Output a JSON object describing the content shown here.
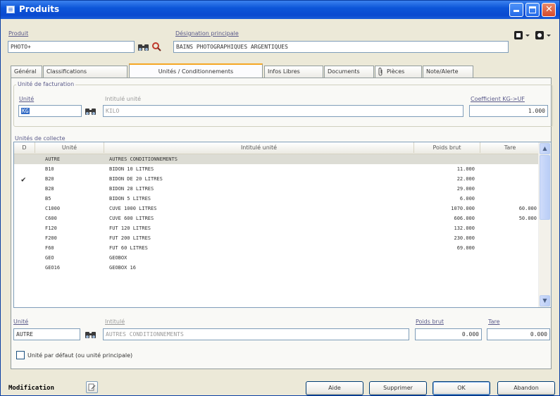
{
  "window": {
    "title": "Produits"
  },
  "header": {
    "product_label": "Produit",
    "product_value": "PHOTO+",
    "designation_label": "Désignation principale",
    "designation_value": "BAINS PHOTOGRAPHIQUES ARGENTIQUES"
  },
  "tabs": [
    {
      "label": "Général"
    },
    {
      "label": "Classifications"
    },
    {
      "label": "Unités / Conditionnements"
    },
    {
      "label": "Infos Libres"
    },
    {
      "label": "Documents"
    },
    {
      "label": "Pièces"
    },
    {
      "label": "Note/Alerte"
    }
  ],
  "billing": {
    "group_title": "Unité de facturation",
    "unit_label": "Unité",
    "unit_value": "KG",
    "intitule_label": "Intitulé unité",
    "intitule_value": "KILO",
    "coef_label": "Coefficient KG->UF",
    "coef_value": "1.000"
  },
  "collection": {
    "group_title": "Unités de collecte",
    "columns": [
      "D",
      "Unité",
      "Intitulé unité",
      "Poids brut",
      "Tare"
    ],
    "rows": [
      {
        "default": "",
        "unit": "AUTRE",
        "label": "AUTRES CONDITIONNEMENTS",
        "weight": "",
        "tare": ""
      },
      {
        "default": "",
        "unit": "B10",
        "label": "BIDON 10 LITRES",
        "weight": "11.000",
        "tare": ""
      },
      {
        "default": "✔",
        "unit": "B20",
        "label": "BIDON DE 20 LITRES",
        "weight": "22.000",
        "tare": ""
      },
      {
        "default": "",
        "unit": "B28",
        "label": "BIDON 28 LITRES",
        "weight": "29.000",
        "tare": ""
      },
      {
        "default": "",
        "unit": "B5",
        "label": "BIDON 5 LITRES",
        "weight": "6.000",
        "tare": ""
      },
      {
        "default": "",
        "unit": "C1000",
        "label": "CUVE 1000 LITRES",
        "weight": "1070.000",
        "tare": "60.000"
      },
      {
        "default": "",
        "unit": "C600",
        "label": "CUVE 600 LITRES",
        "weight": "606.000",
        "tare": "50.000"
      },
      {
        "default": "",
        "unit": "F120",
        "label": "FUT 120 LITRES",
        "weight": "132.000",
        "tare": ""
      },
      {
        "default": "",
        "unit": "F200",
        "label": "FUT 200 LITRES",
        "weight": "230.000",
        "tare": ""
      },
      {
        "default": "",
        "unit": "F60",
        "label": "FUT 60 LITRES",
        "weight": "69.000",
        "tare": ""
      },
      {
        "default": "",
        "unit": "GEO",
        "label": "GEOBOX",
        "weight": "",
        "tare": ""
      },
      {
        "default": "",
        "unit": "GEO16",
        "label": "GEOBOX 16",
        "weight": "",
        "tare": ""
      }
    ]
  },
  "detail": {
    "unit_label": "Unité",
    "unit_value": "AUTRE",
    "intitule_label": "Intitulé",
    "intitule_value": "AUTRES CONDITIONNEMENTS",
    "weight_label": "Poids brut",
    "weight_value": "0.000",
    "tare_label": "Tare",
    "tare_value": "0.000",
    "default_checkbox_label": "Unité par défaut (ou unité principale)"
  },
  "footer": {
    "modification_label": "Modification",
    "buttons": {
      "aide": "Aide",
      "supprimer": "Supprimer",
      "ok": "OK",
      "abandon": "Abandon"
    }
  },
  "icons": [
    "app-list-icon",
    "binoculars-icon",
    "magnifier-icon",
    "document-dropdown-icon",
    "settings-dropdown-icon",
    "minimize-icon",
    "maximize-icon",
    "close-icon",
    "check-icon",
    "paperclip-icon",
    "edit-icon"
  ],
  "colors": {
    "titlebar": "#0a4ad0",
    "tab_accent": "#f5a623",
    "selected_row": "#dcdcd4"
  }
}
